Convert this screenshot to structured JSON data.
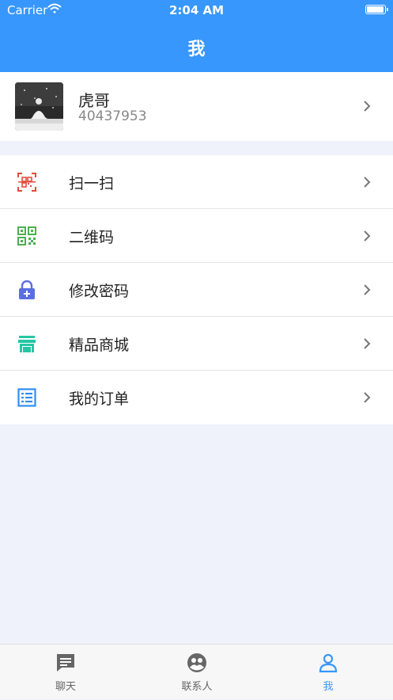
{
  "status_bar": {
    "carrier": "Carrier",
    "time": "2:04 AM",
    "battery_level": 1.0
  },
  "nav": {
    "title": "我"
  },
  "profile": {
    "name": "虎哥",
    "id": "40437953"
  },
  "menu": {
    "items": [
      {
        "label": "扫一扫",
        "icon": "scan-icon",
        "color": "#e64a3b"
      },
      {
        "label": "二维码",
        "icon": "qrcode-icon",
        "color": "#4caf50"
      },
      {
        "label": "修改密码",
        "icon": "lock-icon",
        "color": "#5b6ee1"
      },
      {
        "label": "精品商城",
        "icon": "store-icon",
        "color": "#26c6a4"
      },
      {
        "label": "我的订单",
        "icon": "order-list-icon",
        "color": "#2f8ef0"
      }
    ]
  },
  "tabs": [
    {
      "label": "聊天",
      "icon": "chat-icon",
      "active": false
    },
    {
      "label": "联系人",
      "icon": "contacts-icon",
      "active": false
    },
    {
      "label": "我",
      "icon": "person-icon",
      "active": true
    }
  ],
  "colors": {
    "accent": "#3797fd",
    "background": "#eff1fb",
    "tab_inactive": "#666666"
  }
}
